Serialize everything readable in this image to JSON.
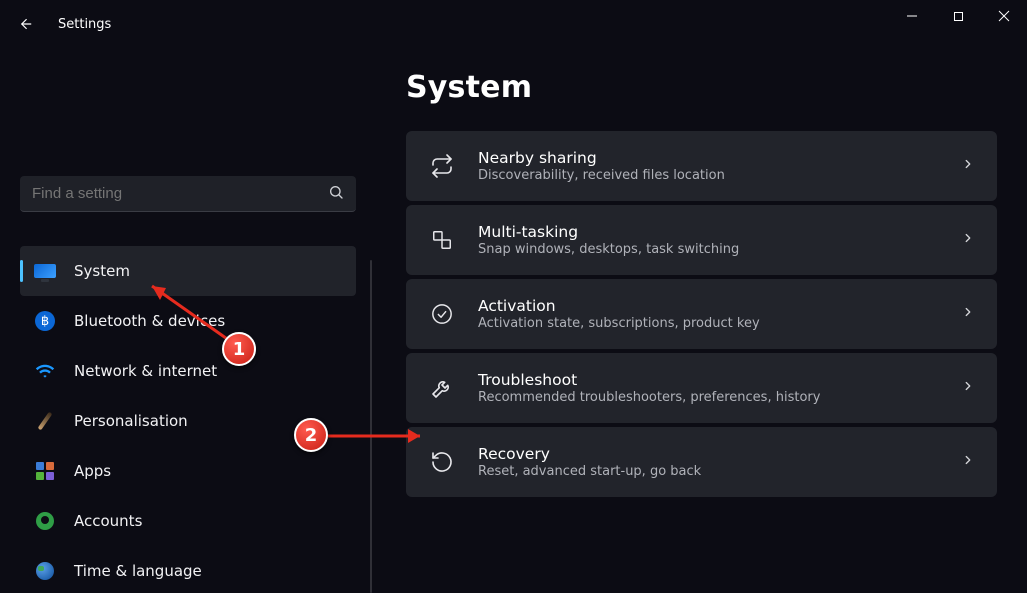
{
  "app": {
    "title": "Settings"
  },
  "search": {
    "placeholder": "Find a setting"
  },
  "sidebar": {
    "items": [
      {
        "label": "System"
      },
      {
        "label": "Bluetooth & devices"
      },
      {
        "label": "Network & internet"
      },
      {
        "label": "Personalisation"
      },
      {
        "label": "Apps"
      },
      {
        "label": "Accounts"
      },
      {
        "label": "Time & language"
      }
    ]
  },
  "page": {
    "title": "System"
  },
  "cards": [
    {
      "title": "Nearby sharing",
      "sub": "Discoverability, received files location"
    },
    {
      "title": "Multi-tasking",
      "sub": "Snap windows, desktops, task switching"
    },
    {
      "title": "Activation",
      "sub": "Activation state, subscriptions, product key"
    },
    {
      "title": "Troubleshoot",
      "sub": "Recommended troubleshooters, preferences, history"
    },
    {
      "title": "Recovery",
      "sub": "Reset, advanced start-up, go back"
    }
  ],
  "annotations": {
    "b1": "1",
    "b2": "2"
  }
}
